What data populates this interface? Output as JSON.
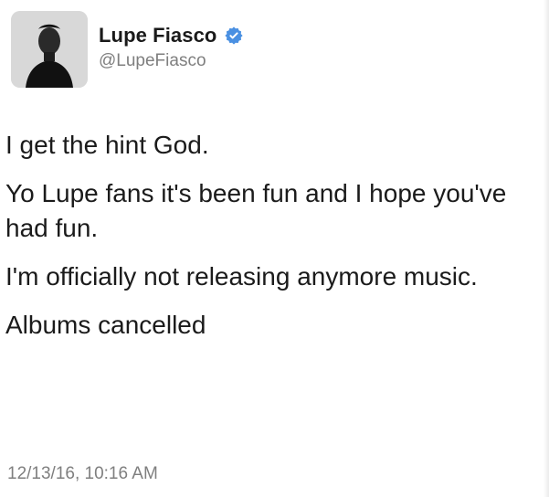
{
  "tweet": {
    "author": {
      "name": "Lupe Fiasco",
      "handle": "@LupeFiasco",
      "verified_icon": "verified-badge-icon",
      "verified_color": "#4a90e2"
    },
    "paragraphs": [
      "I get the hint God.",
      "Yo Lupe fans it's been fun and I hope you've had fun.",
      "I'm officially not releasing anymore music.",
      "Albums cancelled"
    ],
    "timestamp": "12/13/16, 10:16 AM"
  }
}
